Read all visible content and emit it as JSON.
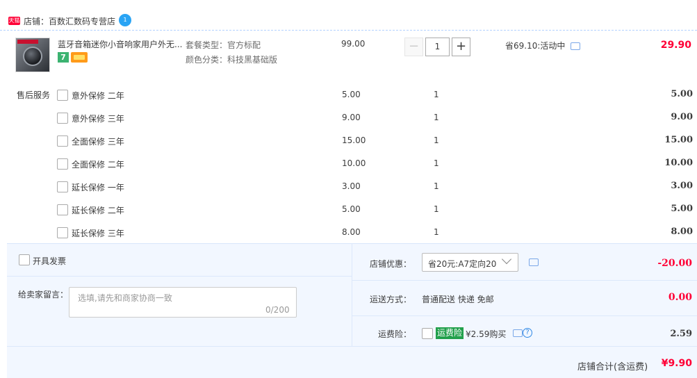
{
  "store": {
    "tmall_badge": "天猫",
    "label": "店铺：百数汇数码专营店",
    "ww_icon": "wangwang-chat-icon",
    "ww_text": "1"
  },
  "item": {
    "title": "蓝牙音箱迷你小音响家用户外无...",
    "badge7": "7",
    "sku_type": "套餐类型：官方标配",
    "sku_color": "颜色分类：科技黑基础版",
    "price": "99.00",
    "qty_minus": "−",
    "qty": "1",
    "qty_plus": "+",
    "promo": "省69.10:活动中",
    "total": "29.90"
  },
  "services": {
    "title": "售后服务",
    "rows": [
      {
        "name": "意外保修 二年",
        "price": "5.00",
        "qty": "1",
        "total": "5.00"
      },
      {
        "name": "意外保修 三年",
        "price": "9.00",
        "qty": "1",
        "total": "9.00"
      },
      {
        "name": "全面保修 三年",
        "price": "15.00",
        "qty": "1",
        "total": "15.00"
      },
      {
        "name": "全面保修 二年",
        "price": "10.00",
        "qty": "1",
        "total": "10.00"
      },
      {
        "name": "延长保修 一年",
        "price": "3.00",
        "qty": "1",
        "total": "3.00"
      },
      {
        "name": "延长保修 二年",
        "price": "5.00",
        "qty": "1",
        "total": "5.00"
      },
      {
        "name": "延长保修 三年",
        "price": "8.00",
        "qty": "1",
        "total": "8.00"
      }
    ]
  },
  "invoice": {
    "label": "开具发票"
  },
  "message": {
    "label": "给卖家留言：",
    "placeholder": "选填,请先和商家协商一致",
    "count": "0/200"
  },
  "coupon": {
    "label": "店铺优惠：",
    "selected": "省20元:A7定向20",
    "amount": "-20.00"
  },
  "shipping": {
    "label": "运送方式：",
    "method": "普通配送 快递 免邮",
    "amount": "0.00"
  },
  "freight_insurance": {
    "label": "运费险：",
    "badge": "运费险",
    "price_text": "¥2.59购买",
    "amount": "2.59"
  },
  "summary": {
    "label": "店铺合计(含运费)",
    "amount": "¥9.90"
  },
  "colors": {
    "accent_red": "#ff0036",
    "panel_bg": "#f2f7ff",
    "tmall_red": "#ff0036",
    "insurance_green": "#22a04c"
  }
}
